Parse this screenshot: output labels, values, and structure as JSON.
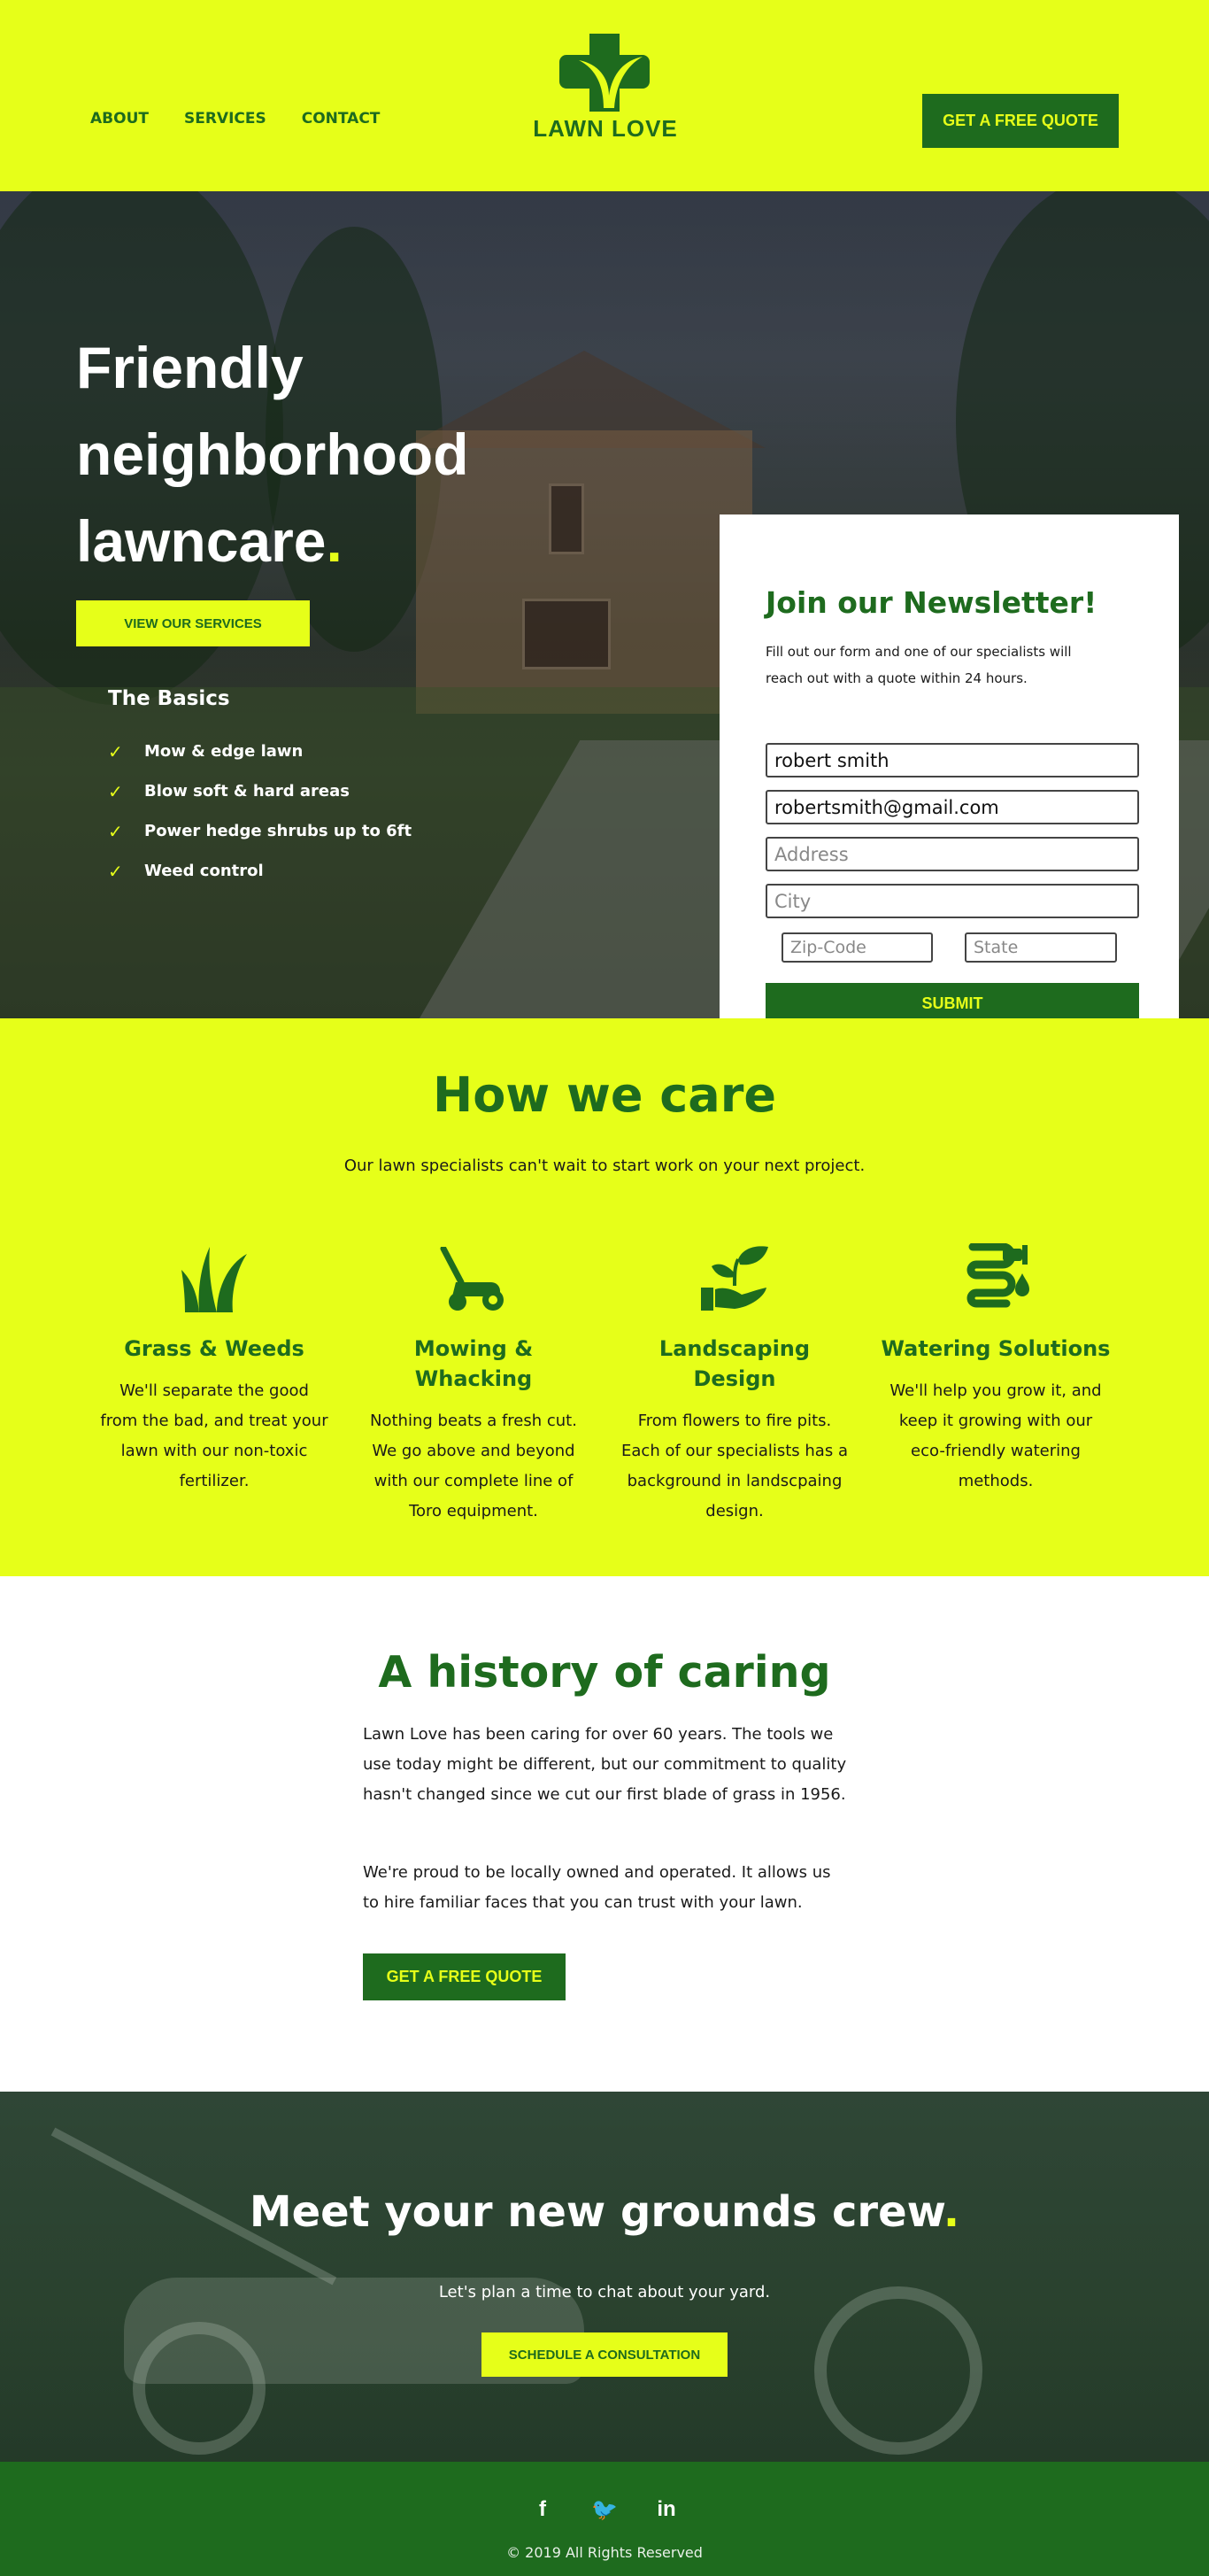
{
  "header": {
    "nav": [
      "ABOUT",
      "SERVICES",
      "CONTACT"
    ],
    "logo_text": "LAWN LOVE",
    "cta": "GET A FREE QUOTE"
  },
  "hero": {
    "title_main": "Friendly neighborhood lawncare",
    "title_dot": ".",
    "button": "VIEW OUR SERVICES",
    "basics_title": "The Basics",
    "basics": [
      "Mow & edge lawn",
      "Blow soft & hard areas",
      "Power hedge shrubs up to 6ft",
      "Weed control"
    ],
    "check": "✓"
  },
  "newsletter": {
    "title": "Join our Newsletter!",
    "text": "Fill out our form and one of our specialists will reach out with a quote within 24 hours.",
    "name_value": "robert smith",
    "email_value": "robertsmith@gmail.com",
    "address_placeholder": "Address",
    "city_placeholder": "City",
    "zip_placeholder": "Zip-Code",
    "state_placeholder": "State",
    "submit": "SUBMIT"
  },
  "care": {
    "title": "How we care",
    "subtitle": "Our lawn specialists can't wait to start work on your next project.",
    "cards": [
      {
        "title": "Grass & Weeds",
        "text": "We'll separate the good from the bad, and treat your lawn with our non-toxic fertilizer.",
        "icon": "grass-icon"
      },
      {
        "title": "Mowing & Whacking",
        "text": "Nothing beats a fresh cut. We go above and beyond with our complete line of Toro equipment.",
        "icon": "lawnmower-icon"
      },
      {
        "title": "Landscaping Design",
        "text": "From flowers to fire pits. Each of our specialists has a background in landscpaing design.",
        "icon": "plant-in-hand-icon"
      },
      {
        "title": "Watering Solutions",
        "text": "We'll help you grow it, and keep it growing with our eco-friendly watering methods.",
        "icon": "hose-icon"
      }
    ]
  },
  "history": {
    "title": "A history of caring",
    "p1": "Lawn Love has been caring for over 60 years. The tools we use today might be different, but our commitment to quality hasn't changed since we cut our first blade of grass in 1956.",
    "p2": "We're proud to be locally owned and operated. It allows us to hire familiar faces that you can trust with your lawn.",
    "button": "GET A FREE QUOTE"
  },
  "crew": {
    "title_main": "Meet your new grounds crew",
    "title_dot": ".",
    "subtitle": "Let's plan a time to chat about your yard.",
    "button": "SCHEDULE A CONSULTATION"
  },
  "footer": {
    "social": [
      "f",
      "🐦",
      "in"
    ],
    "copyright": "© 2019 All Rights Reserved"
  },
  "colors": {
    "accent_yellow": "#e6ff19",
    "brand_green": "#1e6b1e"
  }
}
